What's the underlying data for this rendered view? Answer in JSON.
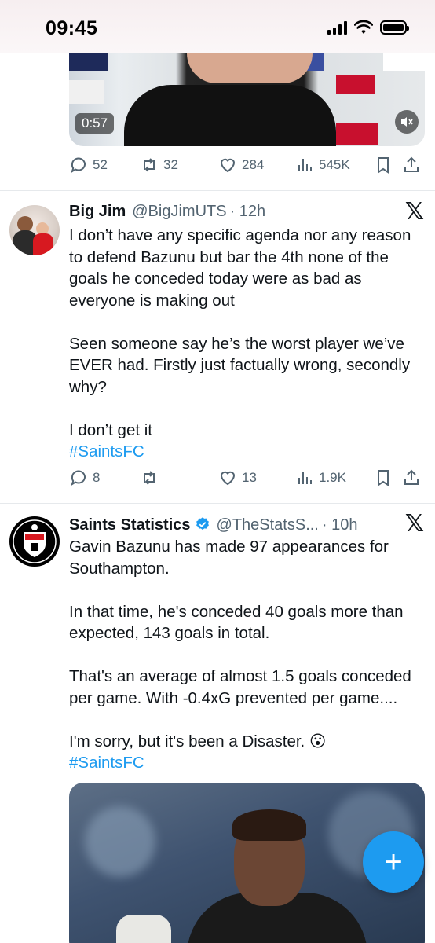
{
  "status_bar": {
    "time": "09:45"
  },
  "top_media": {
    "duration": "0:57"
  },
  "top_actions": {
    "replies": "52",
    "reposts": "32",
    "likes": "284",
    "views": "545K"
  },
  "tweets": [
    {
      "name": "Big Jim",
      "handle": "@BigJimUTS",
      "time": "· 12h",
      "body": [
        "I don’t have any specific agenda nor any reason to defend Bazunu but bar the 4th none of the goals he conceded today were as bad as everyone is making out",
        "Seen someone say he’s the worst player we’ve EVER had. Firstly just factually wrong, secondly why?",
        "I don’t get it"
      ],
      "hashtag": "#SaintsFC",
      "actions": {
        "replies": "8",
        "reposts": "",
        "likes": "13",
        "views": "1.9K"
      }
    },
    {
      "name": "Saints Statistics",
      "handle": "@TheStatsS...",
      "time": "· 10h",
      "verified": true,
      "body": [
        "Gavin Bazunu has made 97 appearances for Southampton.",
        "In that time, he's conceded 40 goals more than expected, 143 goals in total.",
        "That's an average of almost 1.5 goals conceded per game. With -0.4xG prevented per game....",
        "I'm sorry, but it's been a Disaster. 😮"
      ],
      "hashtag": "#SaintsFC"
    }
  ],
  "fab": {
    "label": "+"
  },
  "colors": {
    "accent": "#1d9bf0",
    "muted": "#536471"
  }
}
